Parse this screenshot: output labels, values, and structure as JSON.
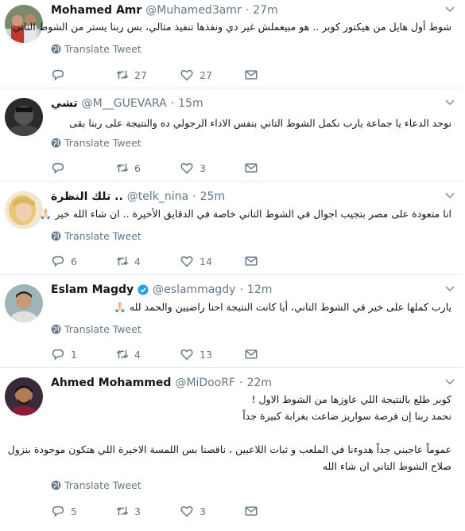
{
  "translate_label": "Translate Tweet",
  "tweets": [
    {
      "name": "Mohamed Amr",
      "handle": "@Muhamed3amr",
      "time": "27m",
      "lines": [
        "شوط أول هايل من هيكتور كوبر .. هو مبيعملش غير دي ونفذها تنفيذ مثالي، بس ربنا يستر من الشوط التاني"
      ],
      "replies": "",
      "retweets": "27",
      "likes": "27"
    },
    {
      "name": "تشي",
      "handle": "@M__GUEVARA",
      "time": "15m",
      "lines": [
        "نوحد الدعاء يا جماعة يارب نكمل الشوط التاني بنفس الاداء الرجولي ده والنتيجة على ربنا بقى"
      ],
      "replies": "",
      "retweets": "6",
      "likes": "3"
    },
    {
      "name": "تلك النظرة ..",
      "handle": "@telk_nina",
      "time": "25m",
      "lines": [
        "انا متعودة على مصر بتجيب اجوال في الشوط التاني خاصة في الدقايق الأخيرة .. ان شاء الله خير 🙏🏻"
      ],
      "replies": "6",
      "retweets": "4",
      "likes": "14"
    },
    {
      "name": "Eslam Magdy",
      "handle": "@eslammagdy",
      "time": "12m",
      "verified": true,
      "lines": [
        "يارب كملها على خير في الشوط التاني، أيا كانت النتيجة احنا راضيين والحمد لله 🙏🏻"
      ],
      "replies": "1",
      "retweets": "4",
      "likes": "13"
    },
    {
      "name": "Ahmed Mohammed",
      "handle": "@MiDooRF",
      "time": "22m",
      "lines": [
        "كوبر طلع بالنتيجة اللي عاوزها من الشوط الاول !",
        "نحمد ربنا إن فرصة سواريز ضاعت بغرابة كبيرة جداً",
        "",
        "عموماً عاجبني جداً هدوءنا في الملعب و ثبات اللاعبين ، ناقصنا بس اللمسة الاخيرة اللي هتكون موجودة بنزول",
        "صلاح الشوط التاني ان شاء الله"
      ],
      "replies": "5",
      "retweets": "3",
      "likes": "3"
    }
  ],
  "colors": {
    "text": "#14171a",
    "muted": "#657786",
    "divider": "#e6ecf0",
    "verified": "#1da1f2"
  }
}
